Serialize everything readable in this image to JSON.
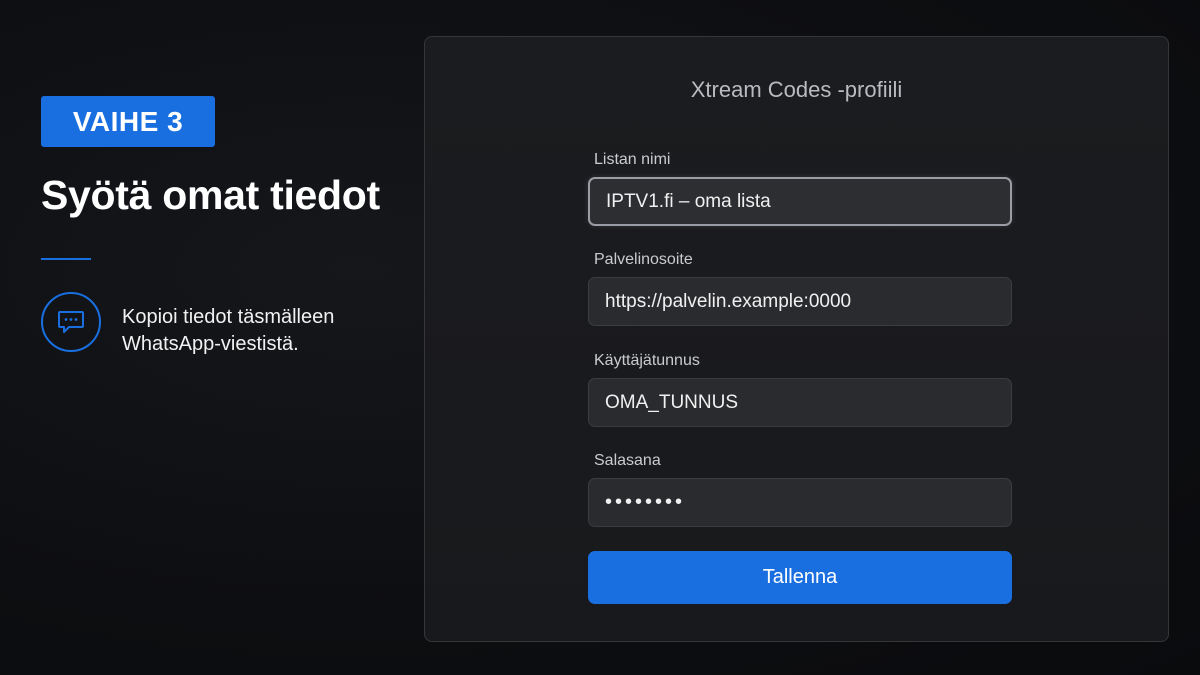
{
  "step": {
    "badge": "VAIHE 3",
    "title": "Syötä omat tiedot"
  },
  "tip": {
    "icon": "chat-bubble-icon",
    "line1": "Kopioi tiedot täsmälleen",
    "line2": "WhatsApp-viestistä."
  },
  "form": {
    "title": "Xtream Codes -profiili",
    "fields": [
      {
        "label": "Listan nimi",
        "value": "IPTV1.fi – oma lista"
      },
      {
        "label": "Palvelinosoite",
        "value": "https://palvelin.example:0000"
      },
      {
        "label": "Käyttäjätunnus",
        "value": "OMA_TUNNUS"
      },
      {
        "label": "Salasana",
        "value": "••••••••"
      }
    ],
    "save_label": "Tallenna"
  },
  "colors": {
    "accent": "#1a6fe0",
    "background": "#0d0e11",
    "panel": "#1b1c1f",
    "field": "#2a2b2f"
  }
}
